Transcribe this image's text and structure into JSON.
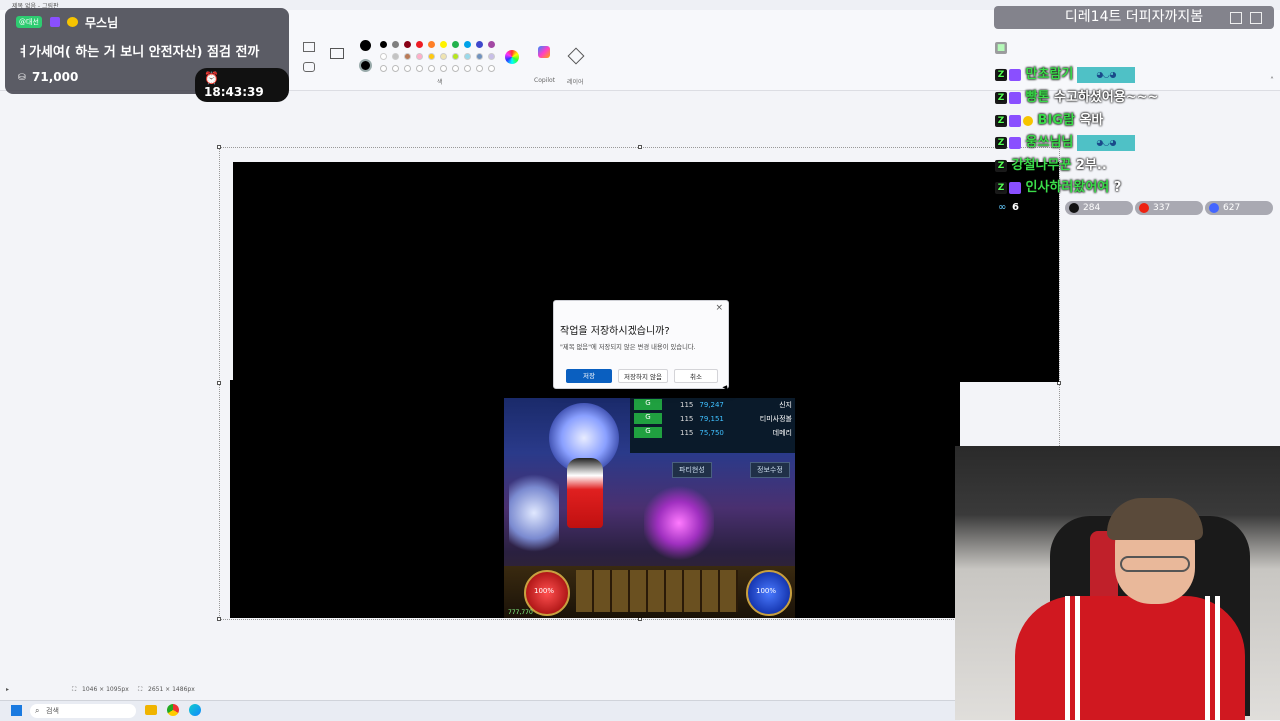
{
  "app": {
    "title_bar": "제목 없음 - 그림판",
    "ribbon": {
      "colors_group_label": "색",
      "copilot_label": "Copilot",
      "layers_label": "레이어",
      "palette_row1": [
        "#000000",
        "#7f7f7f",
        "#880015",
        "#ed1c24",
        "#ff7f27",
        "#fff200",
        "#22b14c",
        "#00a2e8",
        "#3f48cc",
        "#a349a4"
      ],
      "palette_row2": [
        "#ffffff",
        "#c3c3c3",
        "#b97a57",
        "#ffaec9",
        "#ffc90e",
        "#efe4b0",
        "#b5e61d",
        "#99d9ea",
        "#7092be",
        "#c8bfe7"
      ],
      "primary_color": "#000000",
      "secondary_color": "#000000"
    },
    "status_bar": {
      "selection_size": "1046 × 1095px",
      "canvas_size": "2651 × 1486px"
    },
    "taskbar": {
      "search_placeholder": "검색"
    }
  },
  "dialog": {
    "title": "작업을 저장하시겠습니까?",
    "message": "\"제목 없음\"에 저장되지 않은 변경 내용이 있습니다.",
    "save_label": "저장",
    "dont_save_label": "저장하지 않음",
    "cancel_label": "취소",
    "close_symbol": "×"
  },
  "game": {
    "party": [
      {
        "level": "115",
        "hp": "79,247",
        "name": "신지"
      },
      {
        "level": "115",
        "hp": "79,151",
        "name": "티미사정볼"
      },
      {
        "level": "115",
        "hp": "75,750",
        "name": "데메리"
      }
    ],
    "party_badge": "G",
    "party_button": "파티현성",
    "info_button": "정보수정",
    "hp_orb": "100%",
    "mp_orb": "100%",
    "exp_text": "777,770"
  },
  "stream_overlay": {
    "tag": "@대선",
    "donor_name": "무스님",
    "marquee": "ㅕ가세여( 하는 거 보니 안전자산)     점검 전까",
    "coins": "71,000",
    "timer": "18:43:39"
  },
  "chat": {
    "title": "디레14트 더피자까지봄",
    "lines": [
      {
        "user": "만초람기",
        "text": "",
        "emote": true,
        "color": "#3bdc4a"
      },
      {
        "user": "빵톤",
        "text": "수고하셨어용~~~",
        "emote": false,
        "color": "#3bdc4a"
      },
      {
        "user": "BIG람",
        "text": "옥바",
        "emote": false,
        "color": "#3bdc4a"
      },
      {
        "user": "웅쓰님님",
        "text": "",
        "emote": true,
        "color": "#3bdc4a"
      },
      {
        "user": "강철나무꾼",
        "text": "2부..",
        "emote": false,
        "color": "#3bdc4a"
      },
      {
        "user": "인사하러왔어여",
        "text": "?",
        "emote": false,
        "color": "#3bdc4a"
      }
    ],
    "viewer_count": "6",
    "stats": {
      "chzzk": "284",
      "youtube": "337",
      "other": "627"
    }
  }
}
